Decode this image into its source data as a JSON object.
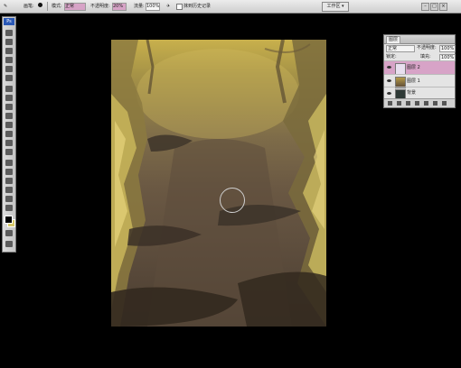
{
  "options_bar": {
    "brush_label": "画笔:",
    "mode_label": "模式:",
    "mode_value": "正常",
    "opacity_label": "不透明度:",
    "opacity_value": "20%",
    "flow_label": "流量:",
    "flow_value": "100%",
    "history_label": "抹到历史记录",
    "workspace_label": "工作区 ▾"
  },
  "toolbox": {
    "logo": "Ps"
  },
  "layers_panel": {
    "tab_label": "图层",
    "blend_mode": "正常",
    "opacity_label": "不透明度:",
    "opacity_value": "100%",
    "lock_label": "锁定:",
    "fill_label": "填充:",
    "fill_value": "100%",
    "layers": [
      {
        "name": "图层 2"
      },
      {
        "name": "图层 1"
      },
      {
        "name": "背景"
      }
    ]
  },
  "colors": {
    "accent": "#d7a3c7",
    "background_color": "#d8c96a"
  }
}
